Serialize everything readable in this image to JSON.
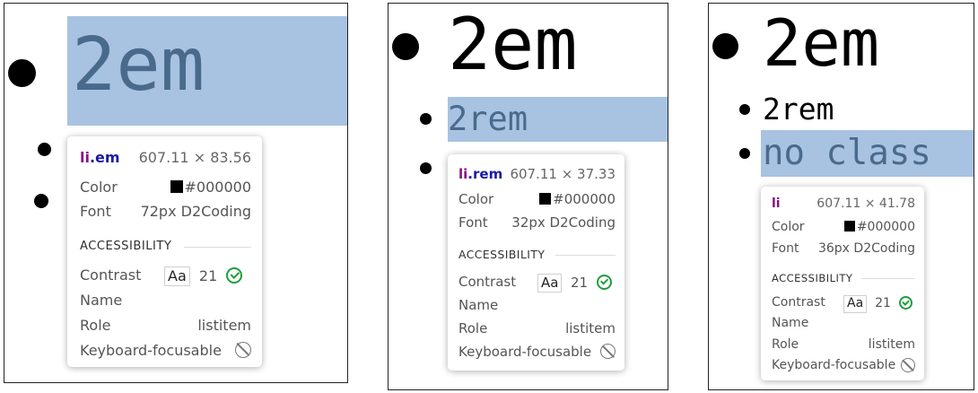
{
  "panels": [
    {
      "items": {
        "large": "2em"
      },
      "tooltip": {
        "tag": "li",
        "cls": ".em",
        "size": "607.11 × 83.56",
        "color_label": "Color",
        "color_value": "#000000",
        "font_label": "Font",
        "font_value": "72px D2Coding",
        "section": "ACCESSIBILITY",
        "contrast_label": "Contrast",
        "aa": "Aa",
        "contrast_value": "21",
        "name_label": "Name",
        "role_label": "Role",
        "role_value": "listitem",
        "keyboard_label": "Keyboard-focusable"
      }
    },
    {
      "items": {
        "large": "2em",
        "medium": "2rem"
      },
      "tooltip": {
        "tag": "li",
        "cls": ".rem",
        "size": "607.11 × 37.33",
        "color_label": "Color",
        "color_value": "#000000",
        "font_label": "Font",
        "font_value": "32px D2Coding",
        "section": "ACCESSIBILITY",
        "contrast_label": "Contrast",
        "aa": "Aa",
        "contrast_value": "21",
        "name_label": "Name",
        "role_label": "Role",
        "role_value": "listitem",
        "keyboard_label": "Keyboard-focusable"
      }
    },
    {
      "items": {
        "large": "2em",
        "medium": "2rem",
        "noclass": "no class"
      },
      "tooltip": {
        "tag": "li",
        "size": "607.11 × 41.78",
        "color_label": "Color",
        "color_value": "#000000",
        "font_label": "Font",
        "font_value": "36px D2Coding",
        "section": "ACCESSIBILITY",
        "contrast_label": "Contrast",
        "aa": "Aa",
        "contrast_value": "21",
        "name_label": "Name",
        "role_label": "Role",
        "role_value": "listitem",
        "keyboard_label": "Keyboard-focusable"
      }
    }
  ],
  "colors": {
    "highlight": "#a8c2e2",
    "tag": "#881280",
    "class": "#1a1aa6",
    "check": "#1e9e3e"
  }
}
